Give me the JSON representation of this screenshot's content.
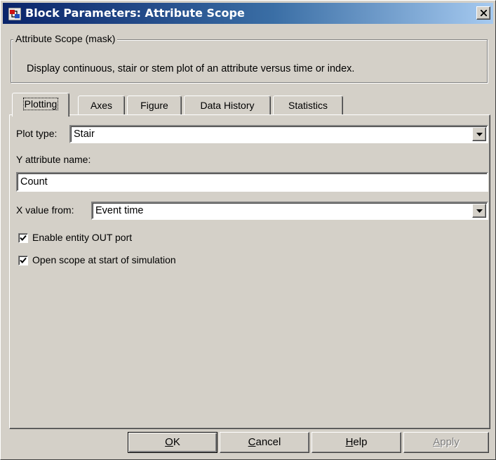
{
  "window": {
    "title": "Block Parameters: Attribute Scope",
    "icon": "simulink-block-icon",
    "close_glyph": "×"
  },
  "mask": {
    "legend": "Attribute Scope (mask)",
    "description": "Display continuous, stair or stem plot of an attribute versus time or index."
  },
  "tabs": [
    {
      "label": "Plotting",
      "active": true
    },
    {
      "label": "Axes",
      "active": false
    },
    {
      "label": "Figure",
      "active": false
    },
    {
      "label": "Data History",
      "active": false
    },
    {
      "label": "Statistics",
      "active": false
    }
  ],
  "plotting": {
    "plot_type_label": "Plot type:",
    "plot_type_value": "Stair",
    "y_attr_label": "Y attribute name:",
    "y_attr_value": "Count",
    "x_value_label": "X value from:",
    "x_value_value": "Event time",
    "enable_out_port_label": "Enable entity OUT port",
    "enable_out_port_checked": true,
    "open_scope_label": "Open scope at start of simulation",
    "open_scope_checked": true
  },
  "buttons": {
    "ok": {
      "mnemonic": "O",
      "rest": "K"
    },
    "cancel": {
      "mnemonic": "C",
      "rest": "ancel"
    },
    "help": {
      "mnemonic": "H",
      "rest": "elp"
    },
    "apply": {
      "mnemonic": "A",
      "rest": "pply",
      "enabled": false
    }
  },
  "colors": {
    "face": "#d4d0c8",
    "title_start": "#0a246a",
    "title_end": "#a6caf0"
  }
}
